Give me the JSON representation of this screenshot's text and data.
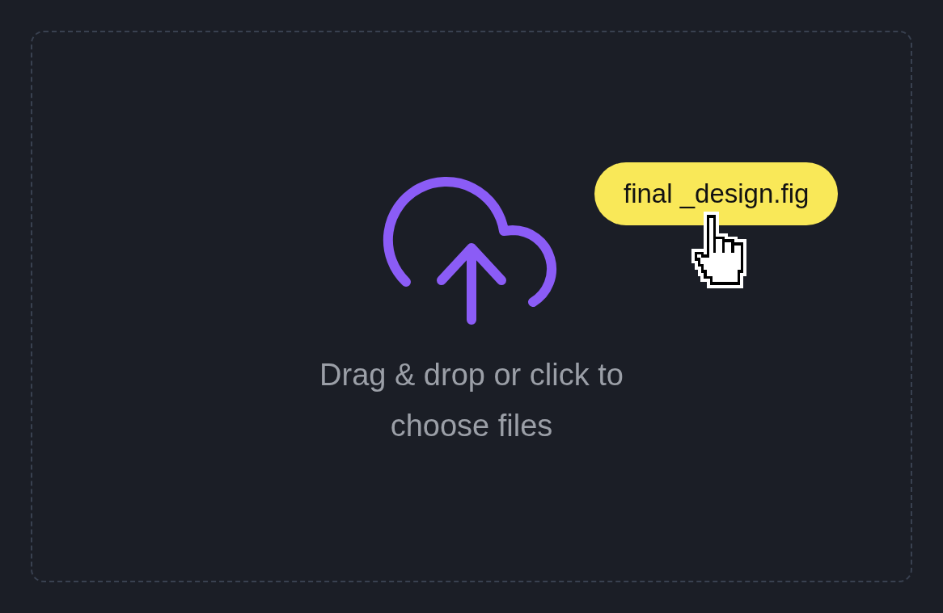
{
  "drop_zone": {
    "prompt": "Drag & drop or click to choose files"
  },
  "dragged_file": {
    "name": "final _design.fig"
  }
}
